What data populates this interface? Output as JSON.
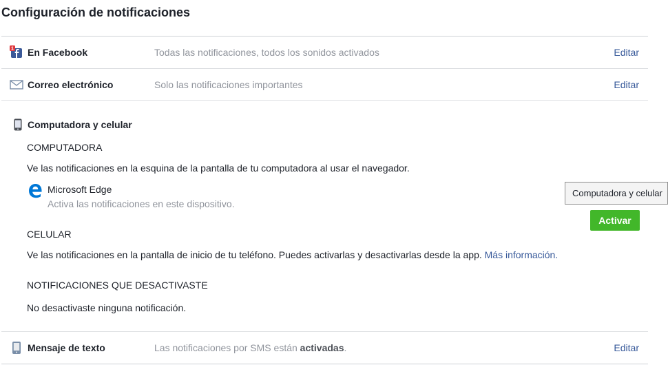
{
  "page": {
    "title": "Configuración de notificaciones"
  },
  "rows": {
    "facebook": {
      "icon": "facebook-notifications-icon",
      "label": "En Facebook",
      "summary": "Todas las notificaciones, todos los sonidos activados",
      "edit": "Editar"
    },
    "email": {
      "icon": "envelope-icon",
      "label": "Correo electrónico",
      "summary": "Solo las notificaciones importantes",
      "edit": "Editar"
    },
    "sms": {
      "icon": "phone-icon",
      "label": "Mensaje de texto",
      "summary_prefix": "Las notificaciones por SMS están ",
      "summary_bold": "activadas",
      "summary_suffix": ".",
      "edit": "Editar"
    }
  },
  "computer_mobile": {
    "icon": "mobile-phone-icon",
    "title": "Computadora y celular",
    "computer": {
      "heading": "COMPUTADORA",
      "description": "Ve las notificaciones en la esquina de la pantalla de tu computadora al usar el navegador.",
      "browser": {
        "icon": "microsoft-edge-icon",
        "name": "Microsoft Edge",
        "description": "Activa las notificaciones en este dispositivo."
      },
      "activate_button": "Activar"
    },
    "mobile": {
      "heading": "CELULAR",
      "description": "Ve las notificaciones en la pantalla de inicio de tu teléfono. Puedes activarlas y desactivarlas desde la app.",
      "more_info_link": "Más información."
    },
    "disabled": {
      "heading": "NOTIFICACIONES QUE DESACTIVASTE",
      "description": "No desactivaste ninguna notificación."
    }
  },
  "tooltip": {
    "text": "Computadora y celular"
  },
  "colors": {
    "link": "#365899",
    "button": "#42b72a",
    "muted": "#90949c",
    "divider": "#dddfe2"
  }
}
